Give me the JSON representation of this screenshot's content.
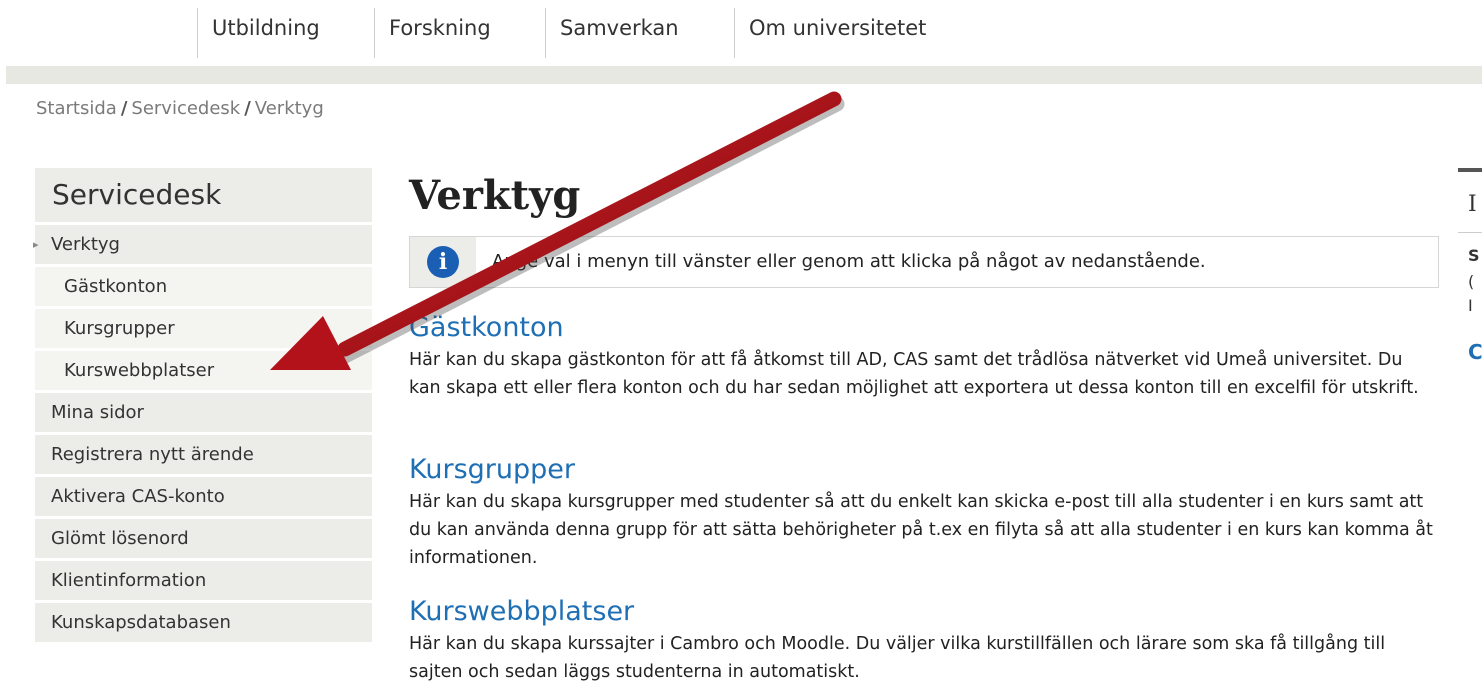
{
  "topnav": {
    "items": [
      {
        "label": "Utbildning"
      },
      {
        "label": "Forskning"
      },
      {
        "label": "Samverkan"
      },
      {
        "label": "Om universitetet"
      }
    ]
  },
  "breadcrumb": {
    "items": [
      "Startsida",
      "Servicedesk",
      "Verktyg"
    ],
    "separator": "/"
  },
  "sidebar": {
    "title": "Servicedesk",
    "active_marker": "▸",
    "items": [
      {
        "label": "Verktyg"
      },
      {
        "label": "Gästkonton"
      },
      {
        "label": "Kursgrupper"
      },
      {
        "label": "Kurswebbplatser"
      },
      {
        "label": "Mina sidor"
      },
      {
        "label": "Registrera nytt ärende"
      },
      {
        "label": "Aktivera CAS-konto"
      },
      {
        "label": "Glömt lösenord"
      },
      {
        "label": "Klientinformation"
      },
      {
        "label": "Kunskapsdatabasen"
      }
    ]
  },
  "main": {
    "title": "Verktyg",
    "info_icon": "i",
    "info_text": "Ange val i menyn till vänster eller genom att klicka på något av nedanstående.",
    "sections": [
      {
        "heading": "Gästkonton",
        "text": "Här kan du skapa gästkonton för att få åtkomst till AD, CAS samt det trådlösa nätverket vid Umeå universitet. Du kan skapa ett eller flera konton och du har sedan möjlighet att exportera ut dessa konton till en excelfil för utskrift."
      },
      {
        "heading": "Kursgrupper",
        "text": "Här kan du skapa kursgrupper med studenter så att du enkelt kan skicka e-post till alla studenter i en kurs samt att du kan använda denna grupp för att sätta behörigheter på t.ex en filyta så att alla studenter i en kurs kan komma åt informationen."
      },
      {
        "heading": "Kurswebbplatser",
        "text": "Här kan du skapa kurssajter i Cambro och Moodle. Du väljer vilka kurstillfällen och lärare som ska få tillgång till sajten och sedan läggs studenterna in automatiskt."
      }
    ]
  },
  "right_panel": {
    "frag1": "I",
    "frag2": "S",
    "frag3": "(",
    "frag4": "I",
    "frag5": "C"
  },
  "colors": {
    "link": "#1f6fb4",
    "sidebar_bg": "#ecece8",
    "arrow": "#b3121a"
  }
}
